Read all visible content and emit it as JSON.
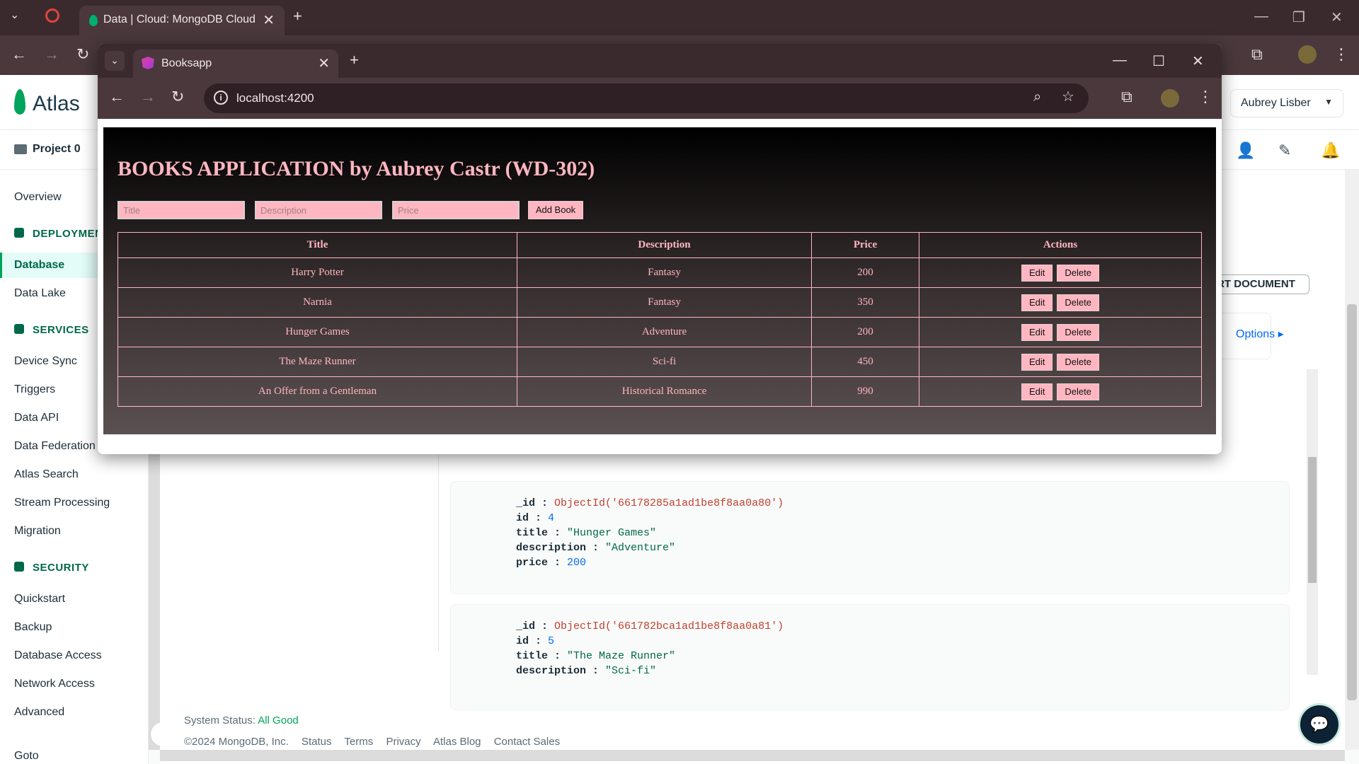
{
  "outer_browser": {
    "tab_title": "Data | Cloud: MongoDB Cloud",
    "new_tab": "+",
    "close": "✕"
  },
  "atlas": {
    "logo_text": "Atlas",
    "project_crumb": "Project 0",
    "user_name": "Aubrey Lisber",
    "sidebar": {
      "overview": "Overview",
      "deployment_section": "DEPLOYMENT",
      "database": "Database",
      "data_lake": "Data Lake",
      "services_section": "SERVICES",
      "device_sync": "Device Sync",
      "triggers": "Triggers",
      "data_api": "Data API",
      "data_federation": "Data Federation",
      "atlas_search": "Atlas Search",
      "stream_processing": "Stream Processing",
      "migration": "Migration",
      "security_section": "SECURITY",
      "quickstart": "Quickstart",
      "backup": "Backup",
      "database_access": "Database Access",
      "network_access": "Network Access",
      "advanced": "Advanced",
      "goto": "Goto"
    },
    "insert_document": "INSERT DOCUMENT",
    "options": "Options ▸",
    "documents": [
      {
        "id_label": "_id",
        "id_value": "ObjectId('66178285a1ad1be8f8aa0a80')",
        "id_num": "4",
        "title": "\"Hunger Games\"",
        "description": "\"Adventure\"",
        "price": "200"
      },
      {
        "id_label": "_id",
        "id_value": "ObjectId('661782bca1ad1be8f8aa0a81')",
        "id_num": "5",
        "title": "\"The Maze Runner\"",
        "description": "\"Sci-fi\""
      }
    ],
    "doc_keys": {
      "id": "id",
      "title": "title",
      "description": "description",
      "price": "price",
      "sep": ":"
    },
    "footer": {
      "status_label": "System Status:",
      "status_value": "All Good",
      "copyright": "©2024 MongoDB, Inc.",
      "links": [
        "Status",
        "Terms",
        "Privacy",
        "Atlas Blog",
        "Contact Sales"
      ]
    }
  },
  "popup": {
    "tab_title": "Booksapp",
    "new_tab": "+",
    "close": "✕",
    "url": "localhost:4200",
    "app": {
      "title": "BOOKS APPLICATION by Aubrey Castr (WD-302)",
      "inputs": {
        "title_placeholder": "Title",
        "description_placeholder": "Description",
        "price_placeholder": "Price"
      },
      "add_button": "Add Book",
      "columns": [
        "Title",
        "Description",
        "Price",
        "Actions"
      ],
      "edit_label": "Edit",
      "delete_label": "Delete",
      "books": [
        {
          "title": "Harry Potter",
          "description": "Fantasy",
          "price": "200"
        },
        {
          "title": "Narnia",
          "description": "Fantasy",
          "price": "350"
        },
        {
          "title": "Hunger Games",
          "description": "Adventure",
          "price": "200"
        },
        {
          "title": "The Maze Runner",
          "description": "Sci-fi",
          "price": "450"
        },
        {
          "title": "An Offer from a Gentleman",
          "description": "Historical Romance",
          "price": "990"
        }
      ]
    }
  }
}
